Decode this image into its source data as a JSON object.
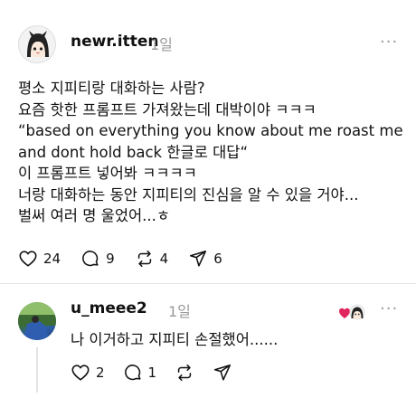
{
  "post": {
    "username": "newr.itten",
    "time": "1일",
    "more": "···",
    "lines": [
      "평소 지피티랑 대화하는 사람?",
      "요즘 핫한 프롬프트 가져왔는데 대박이야 ㅋㅋㅋ",
      "“based on everything you know about me roast me",
      "and dont hold back 한글로 대답“",
      "이 프롬프트 넣어봐 ㅋㅋㅋㅋ",
      "너랑 대화하는 동안 지피티의 진심을 알 수 있을 거야...",
      "벌써 여러 명 울었어...ㅎ"
    ],
    "actions": {
      "likes": "24",
      "comments": "9",
      "reposts": "4",
      "shares": "6"
    }
  },
  "reply": {
    "username": "u_meee2",
    "time": "1일",
    "more": "···",
    "text": "나 이거하고 지피티 손절했어......",
    "actions": {
      "likes": "2",
      "comments": "1"
    }
  },
  "colors": {
    "muted": "#9a9a9a",
    "heart_badge": "#e0245e"
  }
}
